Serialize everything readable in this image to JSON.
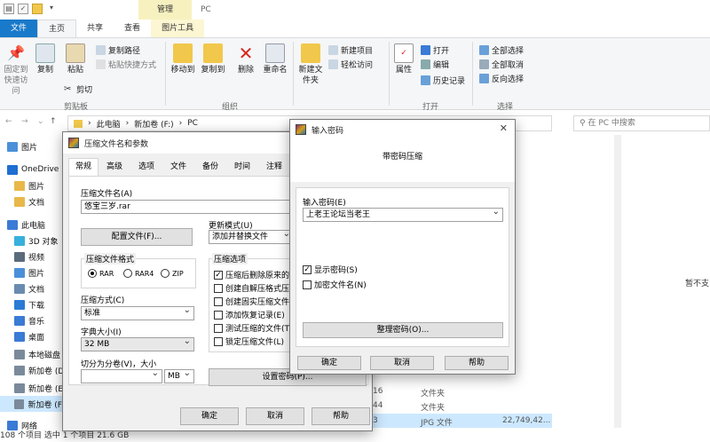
{
  "explorer": {
    "title": "PC",
    "manage_label": "管理",
    "tabs": [
      "文件",
      "主页",
      "共享",
      "查看",
      "图片工具"
    ],
    "ribbon": {
      "pin_label": "固定到快速访问",
      "copy_label": "复制",
      "paste_label": "粘贴",
      "copy_path": "复制路径",
      "paste_shortcut": "粘贴快捷方式",
      "cut": "剪切",
      "group_clipboard": "剪贴板",
      "move_to": "移动到",
      "copy_to": "复制到",
      "delete": "删除",
      "rename": "重命名",
      "group_organize": "组织",
      "new_folder": "新建文件夹",
      "new_item": "新建项目",
      "easy_access": "轻松访问",
      "properties": "属性",
      "open": "打开",
      "edit": "编辑",
      "history": "历史记录",
      "group_open": "打开",
      "select_all": "全部选择",
      "select_none": "全部取消",
      "invert": "反向选择",
      "group_select": "选择"
    },
    "address": [
      "此电脑",
      "新加卷 (F:)",
      "PC"
    ],
    "search_placeholder": "在 PC 中搜索",
    "sidebar": [
      {
        "label": "图片",
        "color": "#4a90d9"
      },
      {
        "label": "OneDrive",
        "color": "#1e6fd0"
      },
      {
        "label": "图片",
        "color": "#e8b84a"
      },
      {
        "label": "文档",
        "color": "#e8b84a"
      },
      {
        "label": "此电脑",
        "color": "#3a7bd5"
      },
      {
        "label": "3D 对象",
        "color": "#38b0de"
      },
      {
        "label": "视频",
        "color": "#5a6b7b"
      },
      {
        "label": "图片",
        "color": "#4a90d9"
      },
      {
        "label": "文档",
        "color": "#6a8bb0"
      },
      {
        "label": "下载",
        "color": "#2b7bd6"
      },
      {
        "label": "音乐",
        "color": "#3a7bd5"
      },
      {
        "label": "桌面",
        "color": "#3a7bd5"
      },
      {
        "label": "本地磁盘",
        "color": "#7a8a9a"
      },
      {
        "label": "新加卷 (D",
        "color": "#7a8a9a"
      },
      {
        "label": "新加卷 (E",
        "color": "#7a8a9a"
      },
      {
        "label": "新加卷 (F",
        "color": "#7a8a9a"
      },
      {
        "label": "网络",
        "color": "#3a7bd5"
      }
    ],
    "list_right_text": "暂不支",
    "rows": [
      {
        "size_frag": "16",
        "type": "文件夹",
        "size": ""
      },
      {
        "size_frag": "44",
        "type": "文件夹",
        "size": ""
      },
      {
        "size_frag": "3",
        "type": "JPG 文件",
        "size": "22,749,42..."
      }
    ],
    "status": "108 个项目    选中 1 个项目  21.6 GB"
  },
  "archive_dialog": {
    "title": "压缩文件名和参数",
    "tabs": [
      "常规",
      "高级",
      "选项",
      "文件",
      "备份",
      "时间",
      "注释"
    ],
    "archive_name_label": "压缩文件名(A)",
    "archive_name_value": "悠宝三岁.rar",
    "profiles_button": "配置文件(F)...",
    "update_mode_label": "更新模式(U)",
    "update_mode_value": "添加并替换文件",
    "format_label": "压缩文件格式",
    "formats": [
      "RAR",
      "RAR4",
      "ZIP"
    ],
    "options_label": "压缩选项",
    "options": [
      {
        "label": "压缩后删除原来的",
        "checked": true
      },
      {
        "label": "创建自解压格式压",
        "checked": false
      },
      {
        "label": "创建固实压缩文件",
        "checked": false
      },
      {
        "label": "添加恢复记录(E)",
        "checked": false
      },
      {
        "label": "测试压缩的文件(T",
        "checked": false
      },
      {
        "label": "锁定压缩文件(L)",
        "checked": false
      }
    ],
    "method_label": "压缩方式(C)",
    "method_value": "标准",
    "dict_label": "字典大小(I)",
    "dict_value": "32 MB",
    "split_label": "切分为分卷(V)，大小",
    "split_unit": "MB",
    "set_password_button": "设置密码(P)...",
    "ok": "确定",
    "cancel": "取消",
    "help": "帮助"
  },
  "password_dialog": {
    "title": "输入密码",
    "heading": "带密码压缩",
    "enter_label": "输入密码(E)",
    "password_value": "上老王论坛当老王",
    "show_password": "显示密码(S)",
    "encrypt_names": "加密文件名(N)",
    "organize_button": "整理密码(O)...",
    "ok": "确定",
    "cancel": "取消",
    "help": "帮助"
  }
}
